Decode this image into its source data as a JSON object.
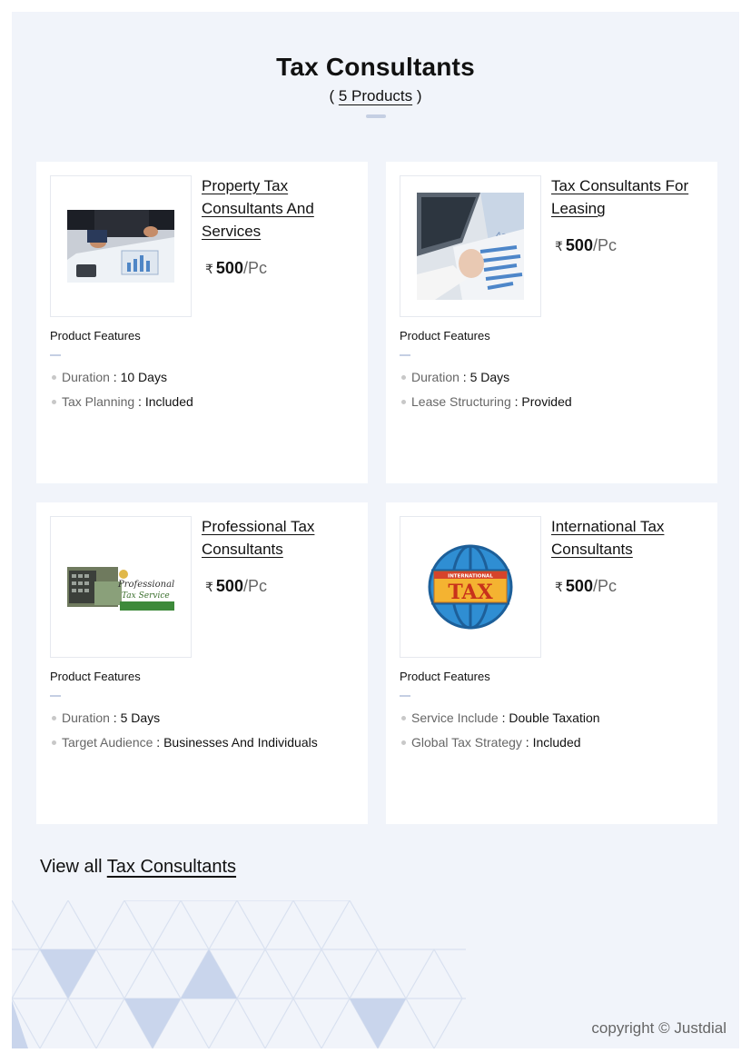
{
  "header": {
    "title": "Tax Consultants",
    "subtitle_open": "(",
    "count_label": "5 Products",
    "subtitle_close": ")"
  },
  "currency_symbol": "₹",
  "products": [
    {
      "name": "Property Tax Consultants And Services",
      "price": "500",
      "unit": "/Pc",
      "features_label": "Product Features",
      "features": [
        {
          "name": "Duration",
          "value": "10 Days"
        },
        {
          "name": "Tax Planning",
          "value": "Included"
        }
      ]
    },
    {
      "name": "Tax Consultants For Leasing",
      "price": "500",
      "unit": "/Pc",
      "features_label": "Product Features",
      "features": [
        {
          "name": "Duration",
          "value": "5 Days"
        },
        {
          "name": "Lease Structuring",
          "value": "Provided"
        }
      ]
    },
    {
      "name": "Professional Tax Consultants",
      "price": "500",
      "unit": "/Pc",
      "features_label": "Product Features",
      "features": [
        {
          "name": "Duration",
          "value": "5 Days"
        },
        {
          "name": "Target Audience",
          "value": "Businesses And Individuals"
        }
      ]
    },
    {
      "name": "International Tax Consultants",
      "price": "500",
      "unit": "/Pc",
      "features_label": "Product Features",
      "features": [
        {
          "name": "Service Include",
          "value": "Double Taxation"
        },
        {
          "name": "Global Tax Strategy",
          "value": "Included"
        }
      ]
    }
  ],
  "images": {
    "img3_line1": "Professional",
    "img3_line2": "Tax Service",
    "img4_top": "INTERNATIONAL",
    "img4_main": "TAX"
  },
  "view_all": {
    "prefix": "View all",
    "link": "Tax Consultants"
  },
  "footer": {
    "copyright": "copyright © Justdial"
  },
  "colors": {
    "page_bg": "#f1f4fa",
    "card_bg": "#ffffff",
    "accent_bar": "#c5cfe3",
    "pattern": "#c9d5ec"
  }
}
